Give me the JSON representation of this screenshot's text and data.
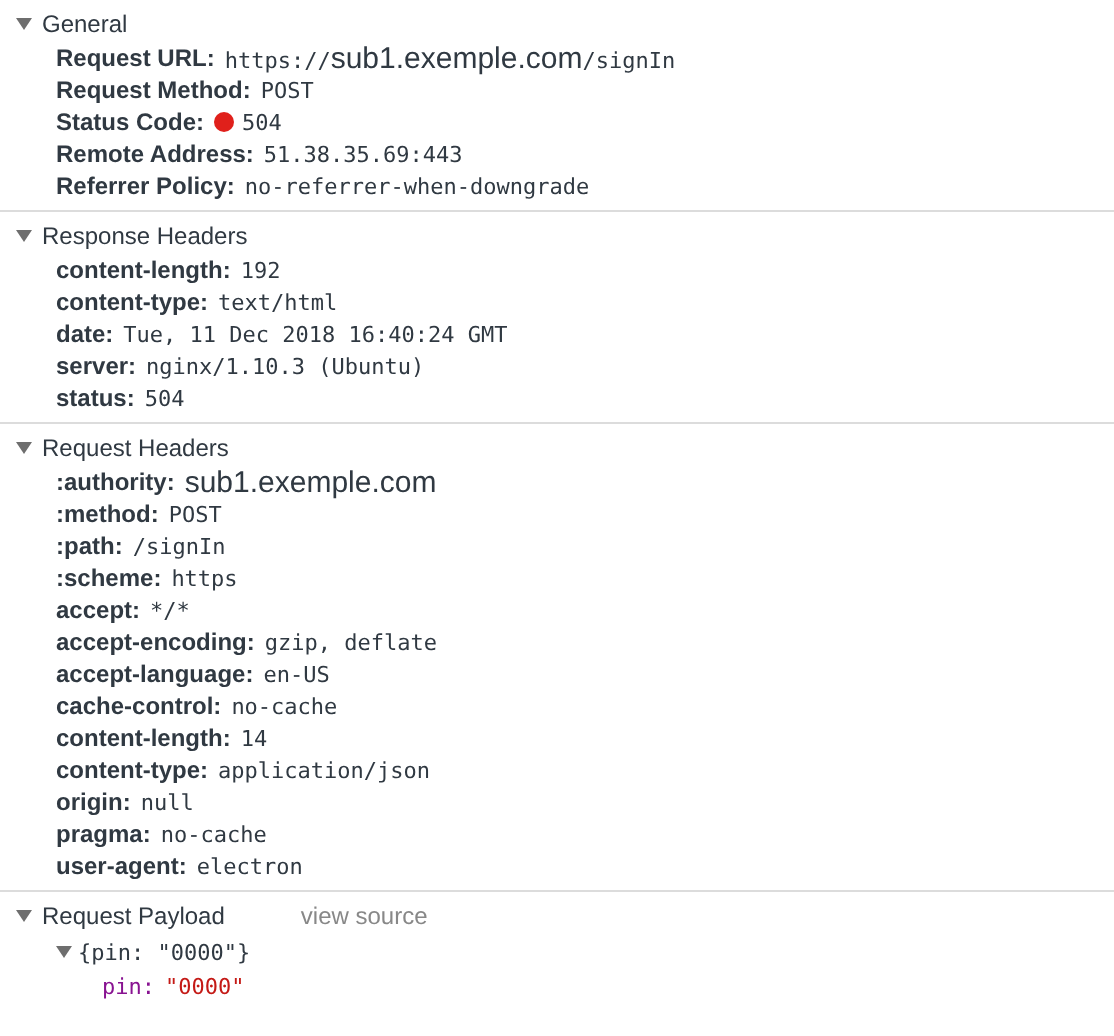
{
  "sections": [
    {
      "title": "General",
      "expanded": true,
      "rows": [
        {
          "name": "Request URL:",
          "value": [
            {
              "kind": "mono",
              "text": "https://"
            },
            {
              "kind": "large",
              "text": "sub1.exemple.com"
            },
            {
              "kind": "mono",
              "text": "/signIn"
            }
          ]
        },
        {
          "name": "Request Method:",
          "value": [
            {
              "kind": "mono",
              "text": "POST"
            }
          ]
        },
        {
          "name": "Status Code:",
          "dot": {
            "color": "#e0201b"
          },
          "value": [
            {
              "kind": "mono",
              "text": "504"
            }
          ]
        },
        {
          "name": "Remote Address:",
          "value": [
            {
              "kind": "mono",
              "text": "51.38.35.69:443"
            }
          ]
        },
        {
          "name": "Referrer Policy:",
          "value": [
            {
              "kind": "mono",
              "text": "no-referrer-when-downgrade"
            }
          ]
        }
      ]
    },
    {
      "title": "Response Headers",
      "expanded": true,
      "rows": [
        {
          "name": "content-length:",
          "value": [
            {
              "kind": "mono",
              "text": "192"
            }
          ]
        },
        {
          "name": "content-type:",
          "value": [
            {
              "kind": "mono",
              "text": "text/html"
            }
          ]
        },
        {
          "name": "date:",
          "value": [
            {
              "kind": "mono",
              "text": "Tue, 11 Dec 2018 16:40:24 GMT"
            }
          ]
        },
        {
          "name": "server:",
          "value": [
            {
              "kind": "mono",
              "text": "nginx/1.10.3 (Ubuntu)"
            }
          ]
        },
        {
          "name": "status:",
          "value": [
            {
              "kind": "mono",
              "text": "504"
            }
          ]
        }
      ]
    },
    {
      "title": "Request Headers",
      "expanded": true,
      "rows": [
        {
          "name": ":authority:",
          "value": [
            {
              "kind": "large",
              "text": "sub1.exemple.com"
            }
          ]
        },
        {
          "name": ":method:",
          "value": [
            {
              "kind": "mono",
              "text": "POST"
            }
          ]
        },
        {
          "name": ":path:",
          "value": [
            {
              "kind": "mono",
              "text": "/signIn"
            }
          ]
        },
        {
          "name": ":scheme:",
          "value": [
            {
              "kind": "mono",
              "text": "https"
            }
          ]
        },
        {
          "name": "accept:",
          "value": [
            {
              "kind": "mono",
              "text": "*/*"
            }
          ]
        },
        {
          "name": "accept-encoding:",
          "value": [
            {
              "kind": "mono",
              "text": "gzip, deflate"
            }
          ]
        },
        {
          "name": "accept-language:",
          "value": [
            {
              "kind": "mono",
              "text": "en-US"
            }
          ]
        },
        {
          "name": "cache-control:",
          "value": [
            {
              "kind": "mono",
              "text": "no-cache"
            }
          ]
        },
        {
          "name": "content-length:",
          "value": [
            {
              "kind": "mono",
              "text": "14"
            }
          ]
        },
        {
          "name": "content-type:",
          "value": [
            {
              "kind": "mono",
              "text": "application/json"
            }
          ]
        },
        {
          "name": "origin:",
          "value": [
            {
              "kind": "mono",
              "text": "null"
            }
          ]
        },
        {
          "name": "pragma:",
          "value": [
            {
              "kind": "mono",
              "text": "no-cache"
            }
          ]
        },
        {
          "name": "user-agent:",
          "value": [
            {
              "kind": "mono",
              "text": "electron"
            }
          ]
        }
      ]
    },
    {
      "title": "Request Payload",
      "expanded": true,
      "link": "view source",
      "payload": {
        "summary": "{pin: \"0000\"}",
        "expanded": true,
        "children": [
          {
            "key": "pin:",
            "value": "\"0000\""
          }
        ]
      }
    }
  ]
}
